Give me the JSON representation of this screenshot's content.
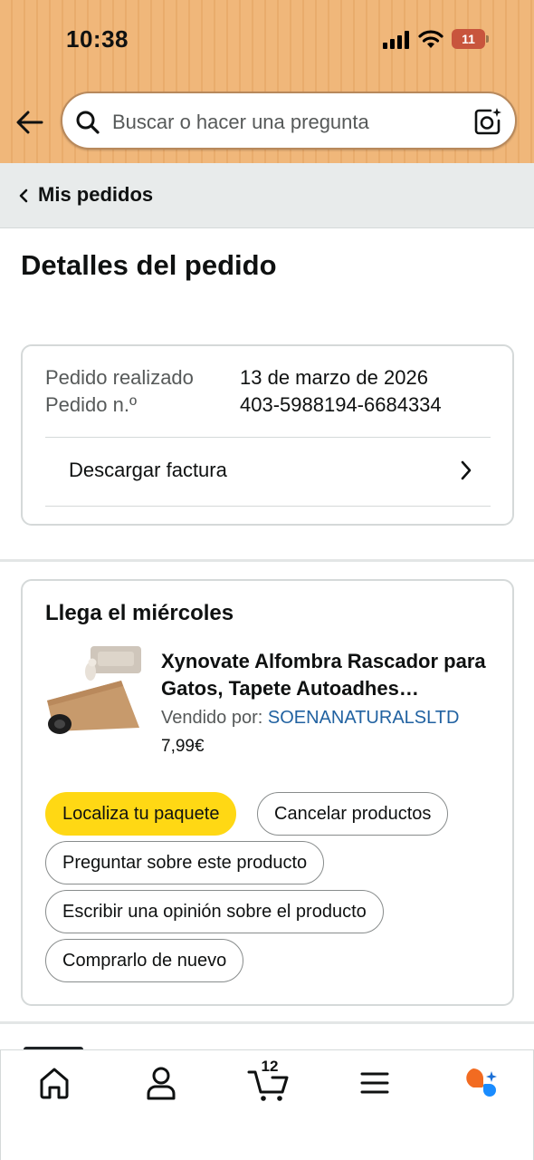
{
  "status_bar": {
    "time": "10:38",
    "battery": "11"
  },
  "search": {
    "placeholder": "Buscar o hacer una pregunta"
  },
  "breadcrumb": {
    "label": "Mis pedidos"
  },
  "page_title": "Detalles del pedido",
  "order_info": {
    "placed_label": "Pedido realizado",
    "placed_value": "13 de marzo de 2026",
    "number_label": "Pedido n.º",
    "number_value": "403-5988194-6684334",
    "invoice_label": "Descargar factura"
  },
  "shipment": {
    "arrival": "Llega el miércoles",
    "product_title": "Xynovate Alfombra Rascador para Gatos, Tapete Autoadhes…",
    "seller_prefix": "Vendido por:",
    "seller_name": "SOENANATURALSLTD",
    "price": "7,99€",
    "actions": {
      "track": "Localiza tu paquete",
      "cancel": "Cancelar productos",
      "ask": "Preguntar sobre este producto",
      "review": "Escribir una opinión sobre el producto",
      "buy_again": "Comprarlo de nuevo"
    }
  },
  "bottom_nav": {
    "items": [
      "home-icon",
      "account-icon",
      "cart-icon",
      "menu-icon",
      "ai-assistant-icon"
    ],
    "cart_count": "12"
  },
  "colors": {
    "header": "#f0b77a",
    "primary_button": "#ffd814",
    "link": "#2162a1",
    "assistant_orange": "#f26b21",
    "assistant_blue": "#1a8cff"
  }
}
